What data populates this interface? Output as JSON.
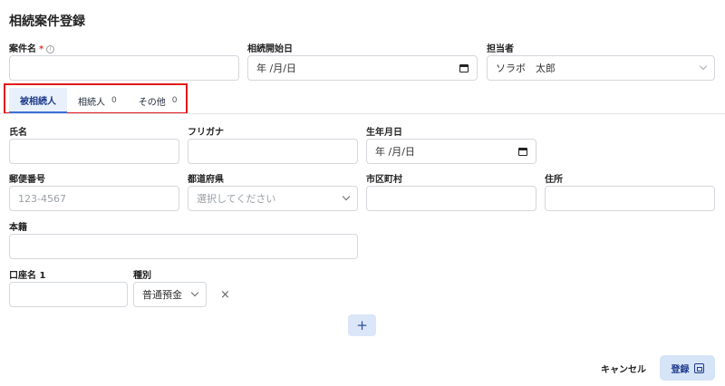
{
  "page": {
    "title": "相続案件登録"
  },
  "case_fields": {
    "case_name_label": "案件名",
    "required_mark": "*",
    "info_icon_glyph": "i",
    "start_date_label": "相続開始日",
    "start_date_value": "年 /月/日",
    "assignee_label": "担当者",
    "assignee_value": "ソラボ　太郎"
  },
  "tabs": [
    {
      "label": "被相続人",
      "count": ""
    },
    {
      "label": "相続人",
      "count": "0"
    },
    {
      "label": "その他",
      "count": "0"
    }
  ],
  "person": {
    "name_label": "氏名",
    "furigana_label": "フリガナ",
    "birthdate_label": "生年月日",
    "birthdate_value": "年 /月/日",
    "postal_label": "郵便番号",
    "postal_placeholder": "123-4567",
    "prefecture_label": "都道府県",
    "prefecture_placeholder": "選択してください",
    "city_label": "市区町村",
    "address_label": "住所",
    "honseki_label": "本籍"
  },
  "account": {
    "account_label": "口座名 1",
    "type_label": "種別",
    "type_value": "普通預金",
    "remove_glyph": "×",
    "add_glyph": "+"
  },
  "footer": {
    "cancel_label": "キャンセル",
    "submit_label": "登録"
  },
  "colors": {
    "accent": "#1e3a8a",
    "highlight_box": "#e0191c",
    "primary_button_bg": "#d6e4f8"
  },
  "icons": [
    "info-icon",
    "calendar-icon",
    "chevron-down-icon",
    "close-icon",
    "plus-icon",
    "save-icon"
  ]
}
